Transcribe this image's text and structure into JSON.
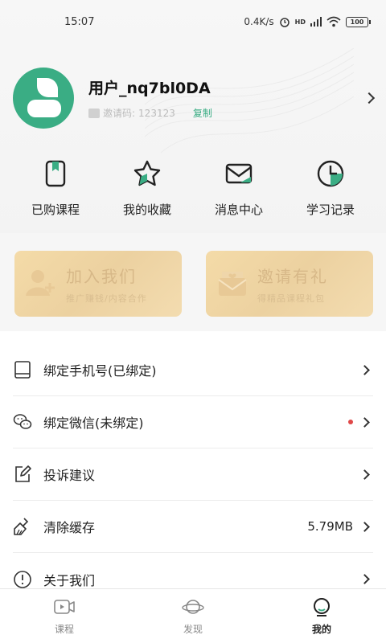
{
  "status_bar": {
    "time": "15:07",
    "net_speed": "0.4K/s",
    "signal": "HD",
    "battery": "100"
  },
  "profile": {
    "username": "用户_nq7bl0DA",
    "invite_label": "邀请码:",
    "invite_code": "123123",
    "copy_label": "复制"
  },
  "quick_nav": [
    {
      "label": "已购课程",
      "icon": "purchased-course-icon"
    },
    {
      "label": "我的收藏",
      "icon": "star-icon"
    },
    {
      "label": "消息中心",
      "icon": "mail-icon"
    },
    {
      "label": "学习记录",
      "icon": "clock-icon"
    }
  ],
  "promo": [
    {
      "title": "加入我们",
      "subtitle": "推广赚钱/内容合作",
      "icon": "add-user-icon"
    },
    {
      "title": "邀请有礼",
      "subtitle": "得精品课程礼包",
      "icon": "envelope-icon"
    }
  ],
  "menu": [
    {
      "label": "绑定手机号(已绑定)",
      "icon": "phone-icon",
      "value": "",
      "dot": false
    },
    {
      "label": "绑定微信(未绑定)",
      "icon": "wechat-icon",
      "value": "",
      "dot": true
    },
    {
      "label": "投诉建议",
      "icon": "edit-icon",
      "value": "",
      "dot": false
    },
    {
      "label": "清除缓存",
      "icon": "broom-icon",
      "value": "5.79MB",
      "dot": false
    },
    {
      "label": "关于我们",
      "icon": "info-icon",
      "value": "",
      "dot": false
    }
  ],
  "tabs": [
    {
      "label": "课程",
      "icon": "video-icon",
      "active": false
    },
    {
      "label": "发现",
      "icon": "planet-icon",
      "active": false
    },
    {
      "label": "我的",
      "icon": "user-icon",
      "active": true
    }
  ],
  "colors": {
    "accent": "#3aad84",
    "promo_gold": "#ecd1a0",
    "dot_red": "#e04848"
  }
}
